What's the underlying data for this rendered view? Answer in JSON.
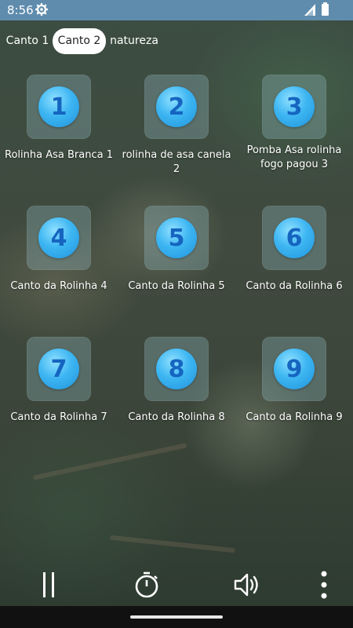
{
  "status_bar": {
    "time": "8:56"
  },
  "tabs": [
    {
      "label": "Canto 1",
      "active": false
    },
    {
      "label": "Canto 2",
      "active": true
    },
    {
      "label": "natureza",
      "active": false
    }
  ],
  "tiles": [
    {
      "number": "1",
      "label": "Rolinha Asa Branca 1"
    },
    {
      "number": "2",
      "label": "rolinha de asa canela 2"
    },
    {
      "number": "3",
      "label": "Pomba Asa rolinha fogo pagou 3"
    },
    {
      "number": "4",
      "label": "Canto da Rolinha 4"
    },
    {
      "number": "5",
      "label": "Canto da Rolinha 5"
    },
    {
      "number": "6",
      "label": "Canto da Rolinha 6"
    },
    {
      "number": "7",
      "label": "Canto da Rolinha 7"
    },
    {
      "number": "8",
      "label": "Canto da Rolinha 8"
    },
    {
      "number": "9",
      "label": "Canto da Rolinha 9"
    }
  ],
  "controls": {
    "pause": "pause-icon",
    "timer": "timer-icon",
    "volume": "volume-icon",
    "more": "more-vertical-icon"
  },
  "colors": {
    "status_bar": "#5f8cad",
    "tile_number": "#1565c0",
    "circle_blue": "#3eb6f2"
  }
}
